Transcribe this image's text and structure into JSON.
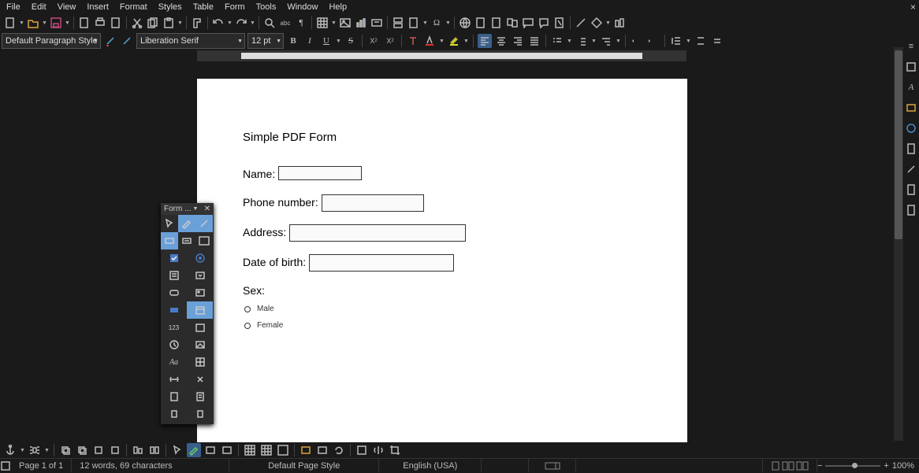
{
  "menu": [
    "File",
    "Edit",
    "View",
    "Insert",
    "Format",
    "Styles",
    "Table",
    "Form",
    "Tools",
    "Window",
    "Help"
  ],
  "paragraph_style": "Default Paragraph Style",
  "font_name": "Liberation Serif",
  "font_size": "12 pt",
  "form_panel": {
    "title": "Form ..."
  },
  "doc": {
    "title": "Simple PDF Form",
    "name_label": "Name:",
    "phone_label": "Phone number:",
    "address_label": "Address:",
    "dob_label": "Date of birth:",
    "sex_label": "Sex:",
    "male": "Male",
    "female": "Female"
  },
  "status": {
    "page": "Page 1 of 1",
    "words": "12 words, 69 characters",
    "page_style": "Default Page Style",
    "language": "English (USA)",
    "zoom": "100%"
  }
}
